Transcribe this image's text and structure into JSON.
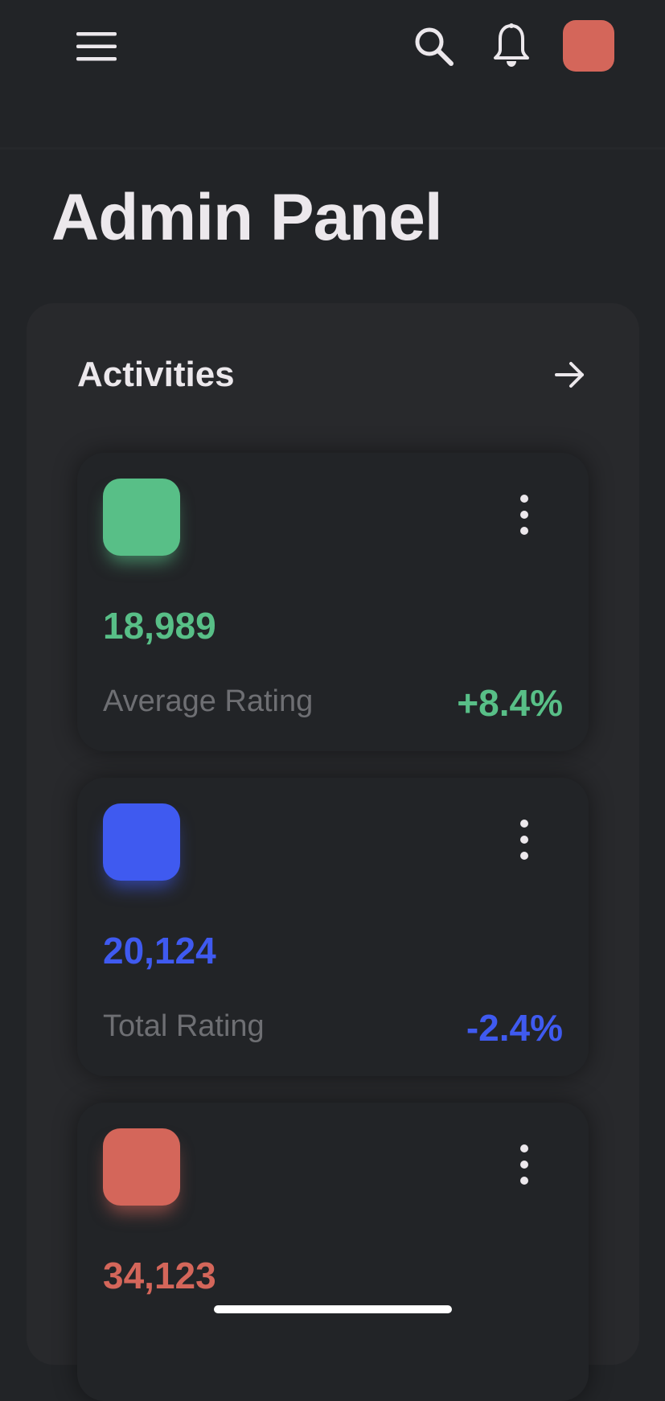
{
  "header": {
    "menu_icon": "hamburger-menu-icon",
    "search_icon": "search-icon",
    "notifications_icon": "bell-icon",
    "avatar_color": "#d4665a"
  },
  "page": {
    "title": "Admin Panel"
  },
  "activities": {
    "title": "Activities",
    "more_icon": "arrow-right-icon",
    "cards": [
      {
        "value": "18,989",
        "label": "Average Rating",
        "change": "+8.4%",
        "color": "#58bf87",
        "menu_icon": "more-vertical-icon"
      },
      {
        "value": "20,124",
        "label": "Total Rating",
        "change": "-2.4%",
        "color": "#3f5af0",
        "menu_icon": "more-vertical-icon"
      },
      {
        "value": "34,123",
        "label": "",
        "change": "",
        "color": "#d4665a",
        "menu_icon": "more-vertical-icon"
      }
    ]
  },
  "colors": {
    "background": "#222427",
    "panel": "#28292c",
    "text_primary": "#ece8ec",
    "text_muted": "#6e6f73"
  }
}
